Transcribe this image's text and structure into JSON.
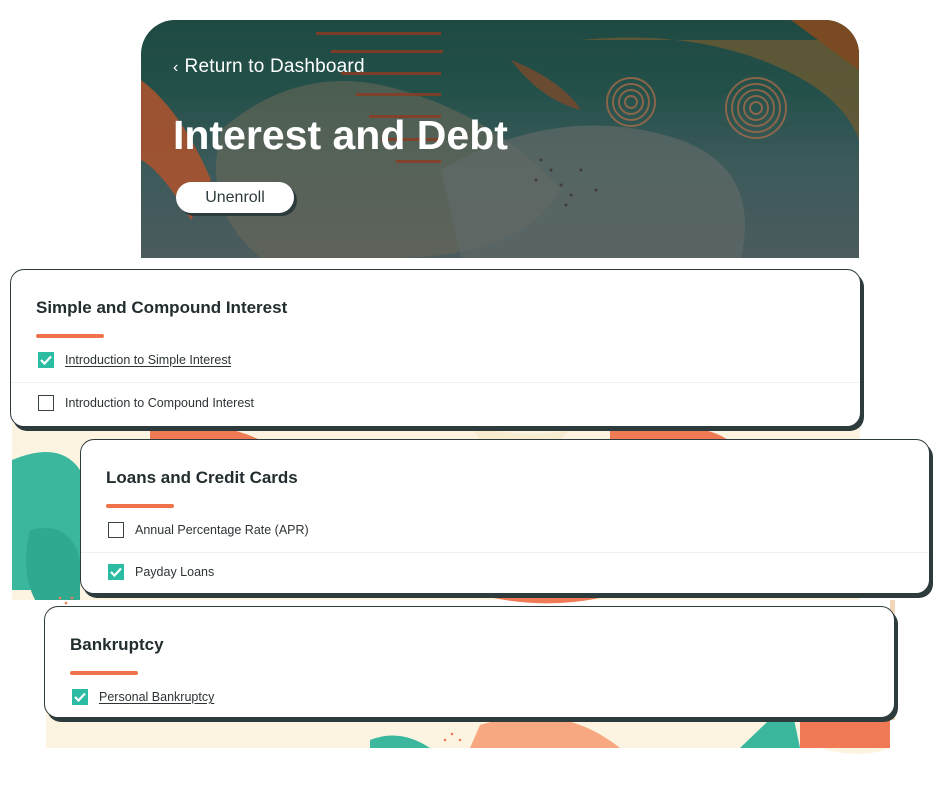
{
  "header": {
    "back_link": "Return to Dashboard",
    "title": "Interest and Debt",
    "unenroll_label": "Unenroll"
  },
  "sections": [
    {
      "title": "Simple and Compound Interest",
      "lessons": [
        {
          "label": "Introduction to Simple Interest",
          "completed": true
        },
        {
          "label": "Introduction to Compound Interest",
          "completed": false
        }
      ]
    },
    {
      "title": "Loans and Credit Cards",
      "lessons": [
        {
          "label": "Annual Percentage Rate (APR)",
          "completed": false
        },
        {
          "label": "Payday Loans",
          "completed": true
        }
      ]
    },
    {
      "title": "Bankruptcy",
      "lessons": [
        {
          "label": "Personal Bankruptcy",
          "completed": true
        }
      ]
    }
  ],
  "colors": {
    "accent": "#f0724a",
    "check": "#2bbca3",
    "hero_dark": "#1e4a43",
    "text_dark": "#222d2f"
  }
}
